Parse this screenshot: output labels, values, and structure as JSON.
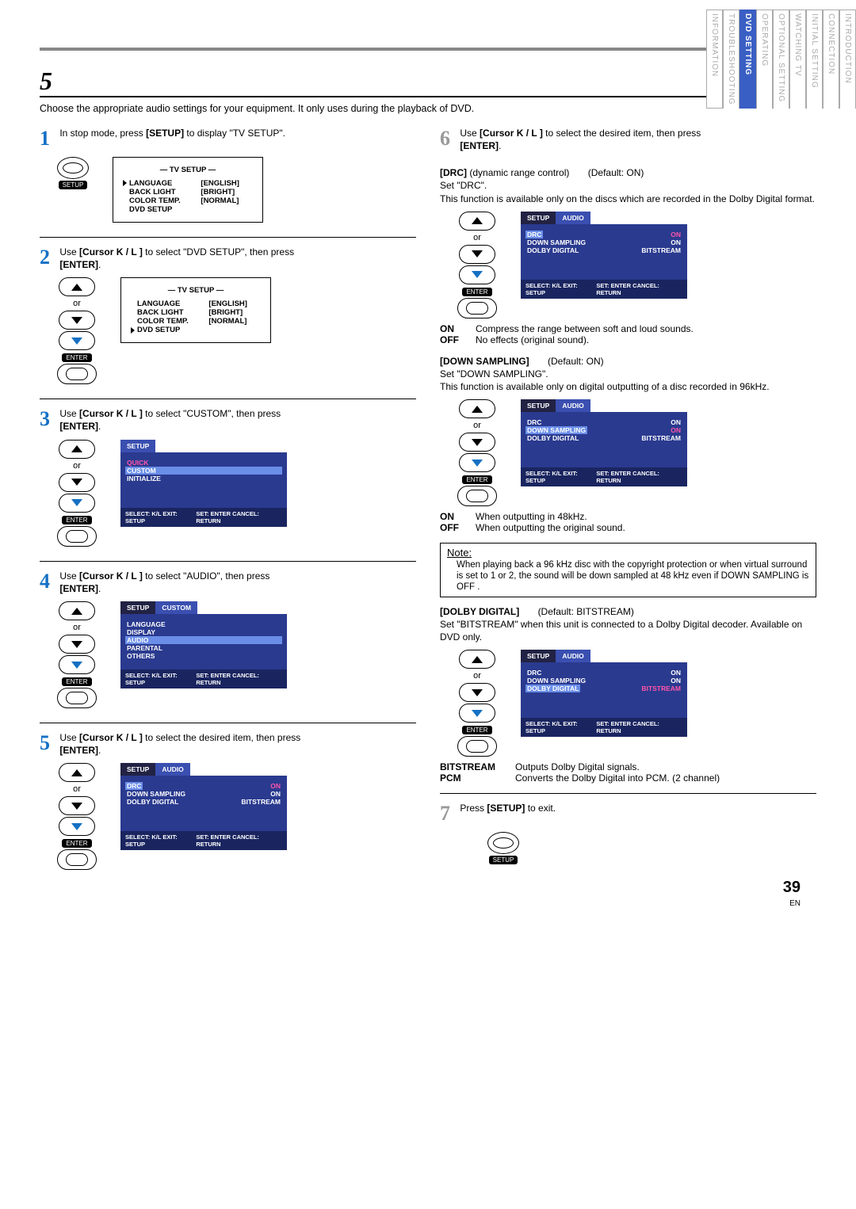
{
  "chapter": {
    "num": "5",
    "title_rest": ""
  },
  "intro": "Choose the appropriate audio settings for your equipment. It only uses during the playback of DVD.",
  "labels": {
    "or": "or",
    "enter_pill": "ENTER",
    "setup_pill": "SETUP",
    "cursor_notation": "[Cursor K / L ]",
    "enter_bold": "[ENTER]",
    "setup_bold": "[SETUP]",
    "note": "Note:"
  },
  "tv_setup_osd": {
    "title": "— TV SETUP —",
    "rows": [
      {
        "l": "LANGUAGE",
        "r": "[ENGLISH]"
      },
      {
        "l": "BACK LIGHT",
        "r": "[BRIGHT]"
      },
      {
        "l": "COLOR TEMP.",
        "r": "[NORMAL]"
      },
      {
        "l": "DVD SETUP",
        "r": ""
      }
    ]
  },
  "setup_main_osd": {
    "tab": "SETUP",
    "items": [
      "QUICK",
      "CUSTOM",
      "INITIALIZE"
    ],
    "footer_l": "SELECT: K/L  EXIT: SETUP",
    "footer_r": "SET: ENTER  CANCEL: RETURN"
  },
  "setup_custom_osd": {
    "tabs": [
      "SETUP",
      "CUSTOM"
    ],
    "items": [
      "LANGUAGE",
      "DISPLAY",
      "AUDIO",
      "PARENTAL",
      "OTHERS"
    ],
    "footer_l": "SELECT: K/L  EXIT: SETUP",
    "footer_r": "SET: ENTER  CANCEL: RETURN"
  },
  "setup_audio_osd": {
    "tabs": [
      "SETUP",
      "AUDIO"
    ],
    "rows": [
      {
        "l": "DRC",
        "r": "ON"
      },
      {
        "l": "DOWN SAMPLING",
        "r": "ON"
      },
      {
        "l": "DOLBY DIGITAL",
        "r": "BITSTREAM"
      }
    ],
    "footer_l": "SELECT: K/L  EXIT: SETUP",
    "footer_r": "SET: ENTER  CANCEL: RETURN"
  },
  "steps": {
    "s1": "In stop mode, press [SETUP] to display \"TV SETUP\".",
    "s2a": "Use ",
    "s2b": " to select \"DVD SETUP\", then press ",
    "s3b": " to select \"CUSTOM\", then press ",
    "s4b": " to select \"AUDIO\", then press ",
    "s5b": " to select the desired item, then press ",
    "s6a": "Use ",
    "s6b": " to select the desired item, then press ",
    "s7": "Press [SETUP] to exit."
  },
  "drc": {
    "heading": "[DRC]",
    "paren": "(dynamic range control)",
    "default": "(Default: ON)",
    "set": "Set \"DRC\".",
    "desc": "This function is available only on the discs which are recorded in the Dolby Digital format.",
    "on": "Compress the range between soft and loud sounds.",
    "off": "No effects (original sound)."
  },
  "down": {
    "heading": "[DOWN SAMPLING]",
    "default": "(Default: ON)",
    "set": "Set \"DOWN SAMPLING\".",
    "desc": "This function is available only on digital outputting of a disc recorded in 96kHz.",
    "on": "When outputting in 48kHz.",
    "off": "When outputting the original sound."
  },
  "note_text": "When playing back a 96 kHz disc with the copyright protection or when virtual surround is set to 1 or 2, the sound will be down sampled at 48 kHz even if  DOWN SAMPLING  is  OFF .",
  "dolby": {
    "heading": "[DOLBY DIGITAL]",
    "default": "(Default: BITSTREAM)",
    "desc": "Set \"BITSTREAM\" when this unit is connected to a Dolby Digital decoder. Available on DVD only.",
    "bitstream": "Outputs Dolby Digital signals.",
    "pcm": "Converts the Dolby Digital into PCM. (2 channel)"
  },
  "side_tabs": [
    "INTRODUCTION",
    "CONNECTION",
    "INITIAL SETTING",
    "WATCHING TV",
    "OPTIONAL SETTING",
    "OPERATING",
    "DVD SETTING",
    "TROUBLESHOOTING",
    "INFORMATION"
  ],
  "page_num": "39",
  "page_code": "EN",
  "on_label": "ON",
  "off_label": "OFF",
  "bitstream_label": "BITSTREAM",
  "pcm_label": "PCM",
  "colon": ": "
}
